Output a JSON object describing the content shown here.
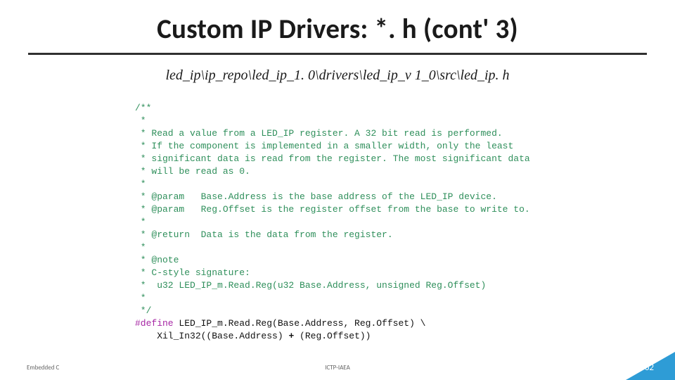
{
  "title": "Custom IP Drivers: *. h (cont' 3)",
  "file_path": "led_ip\\ip_repo\\led_ip_1. 0\\drivers\\led_ip_v 1_0\\src\\led_ip. h",
  "code": {
    "c01": "/**",
    "c02": " *",
    "c03": " * Read a value from a LED_IP register. A 32 bit read is performed.",
    "c04": " * If the component is implemented in a smaller width, only the least",
    "c05": " * significant data is read from the register. The most significant data",
    "c06": " * will be read as 0.",
    "c07": " *",
    "c08": " * @param   Base.Address is the base address of the LED_IP device.",
    "c09": " * @param   Reg.Offset is the register offset from the base to write to.",
    "c10": " *",
    "c11": " * @return  Data is the data from the register.",
    "c12": " *",
    "c13": " * @note",
    "c14": " * C-style signature:",
    "c15": " *  u32 LED_IP_m.Read.Reg(u32 Base.Address, unsigned Reg.Offset)",
    "c16": " *",
    "c17": " */",
    "def_kw": "#define",
    "def_rest": " LED_IP_m.Read.Reg(Base.Address, Reg.Offset) \\",
    "body_a": "    Xil_In32((Base.Address) ",
    "body_plus": "+",
    "body_b": " (Reg.Offset))"
  },
  "footer": {
    "left": "Embedded C",
    "center": "ICTP-IAEA",
    "page": "62"
  }
}
